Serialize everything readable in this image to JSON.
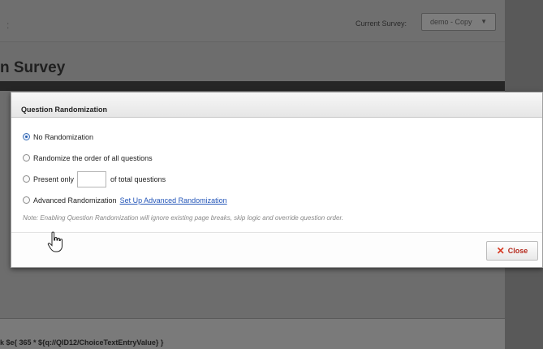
{
  "background": {
    "current_survey_label": "Current Survey:",
    "current_survey_value": "demo - Copy",
    "page_title": "n Survey",
    "formula_text": "k $e{ 365 * ${q://QID12/ChoiceTextEntryValue} }"
  },
  "modal": {
    "title": "Question Randomization",
    "options": [
      {
        "label": "No Randomization",
        "selected": true
      },
      {
        "label": "Randomize the order of all questions",
        "selected": false
      },
      {
        "label_prefix": "Present only",
        "label_suffix": "of total questions",
        "input_value": "",
        "selected": false
      },
      {
        "label": "Advanced Randomization",
        "link": "Set Up Advanced Randomization",
        "selected": false
      }
    ],
    "note": "Note: Enabling Question Randomization will ignore existing page breaks, skip logic and override question order.",
    "close_label": "Close",
    "close_icon": "x-icon"
  }
}
